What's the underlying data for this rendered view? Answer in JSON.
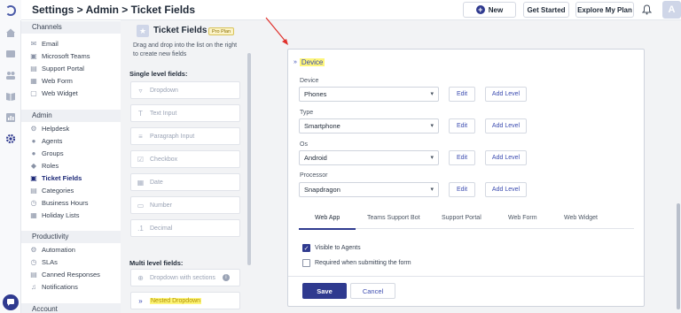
{
  "header": {
    "breadcrumb": "Settings > Admin > Ticket Fields",
    "new_label": "New",
    "get_started_label": "Get Started",
    "explore_plan_label": "Explore My Plan",
    "avatar_initial": "A"
  },
  "nav": {
    "sections": [
      {
        "title": "Channels",
        "items": [
          "Email",
          "Microsoft Teams",
          "Support Portal",
          "Web Form",
          "Web Widget"
        ]
      },
      {
        "title": "Admin",
        "items": [
          "Helpdesk",
          "Agents",
          "Groups",
          "Roles",
          "Ticket Fields",
          "Categories",
          "Business Hours",
          "Holiday Lists"
        ]
      },
      {
        "title": "Productivity",
        "items": [
          "Automation",
          "SLAs",
          "Canned Responses",
          "Notifications"
        ]
      },
      {
        "title": "Account",
        "items": []
      }
    ],
    "active_item": "Ticket Fields"
  },
  "palette": {
    "title": "Ticket Fields",
    "badge": "Pro Plan",
    "description": "Drag and drop into the list on the right to create new fields",
    "single_level_label": "Single level fields:",
    "single_level_fields": [
      "Dropdown",
      "Text Input",
      "Paragraph Input",
      "Checkbox",
      "Date",
      "Number",
      "Decimal"
    ],
    "multi_level_label": "Multi level fields:",
    "multi_level_fields": [
      "Dropdown with sections",
      "Nested Dropdown"
    ]
  },
  "card": {
    "title": "Device",
    "rows": [
      {
        "label": "Device",
        "value": "Phones"
      },
      {
        "label": "Type",
        "value": "Smartphone"
      },
      {
        "label": "Os",
        "value": "Android"
      },
      {
        "label": "Processor",
        "value": "Snapdragon"
      }
    ],
    "edit_label": "Edit",
    "add_level_label": "Add Level",
    "tabs": [
      "Web App",
      "Teams Support Bot",
      "Support Portal",
      "Web Form",
      "Web Widget"
    ],
    "active_tab": "Web App",
    "visible_to_agents_label": "Visible to Agents",
    "visible_to_agents_checked": true,
    "required_label": "Required when submitting the form",
    "required_checked": false,
    "save_label": "Save",
    "cancel_label": "Cancel"
  },
  "colors": {
    "accent": "#2f3a8f",
    "highlight": "#fdf57a",
    "annotation": "#e0302b"
  }
}
